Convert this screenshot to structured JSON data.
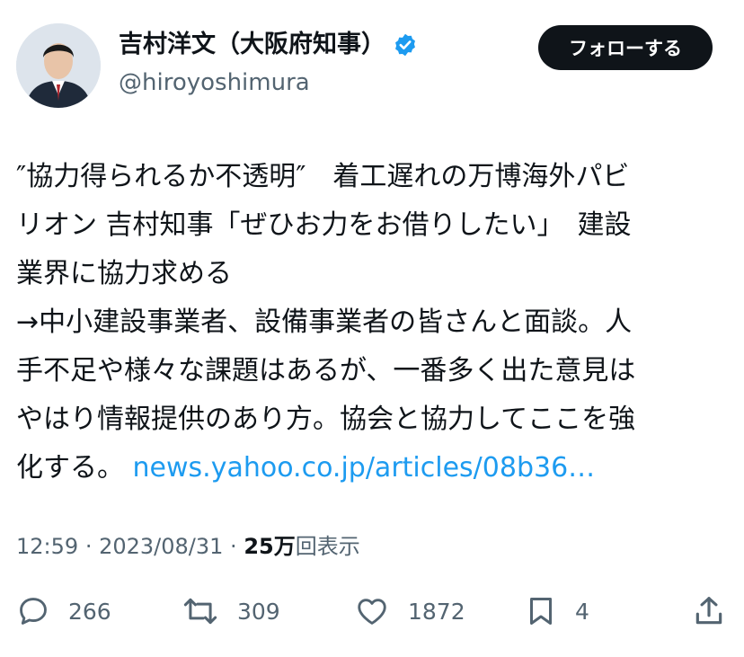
{
  "author": {
    "display_name": "吉村洋文（大阪府知事）",
    "handle": "@hiroyoshimura",
    "verified": true,
    "avatar_icon": "profile-photo"
  },
  "follow_button": {
    "label": "フォローする"
  },
  "tweet": {
    "lines": [
      "″協力得られるか不透明″　着工遅れの万博海外パビ",
      "リオン 吉村知事「ぜひお力をお借りしたい」　建設",
      "業界に協力求める",
      "→中小建設事業者、設備事業者の皆さんと面談。人",
      "手不足や様々な課題はあるが、一番多く出た意見は",
      "やはり情報提供のあり方。協会と協力してここを強"
    ],
    "last_line_text": "化する。 ",
    "link_text": "news.yahoo.co.jp/articles/08b36…"
  },
  "meta": {
    "time": "12:59",
    "date": "2023/08/31",
    "views": "25万",
    "views_label": "回表示"
  },
  "actions": {
    "reply_count": "266",
    "retweet_count": "309",
    "like_count": "1872",
    "bookmark_count": "4"
  },
  "colors": {
    "link": "#1d9bf0",
    "verified_badge": "#1d9bf0",
    "secondary_text": "#536471",
    "button_bg": "#0f1419"
  }
}
